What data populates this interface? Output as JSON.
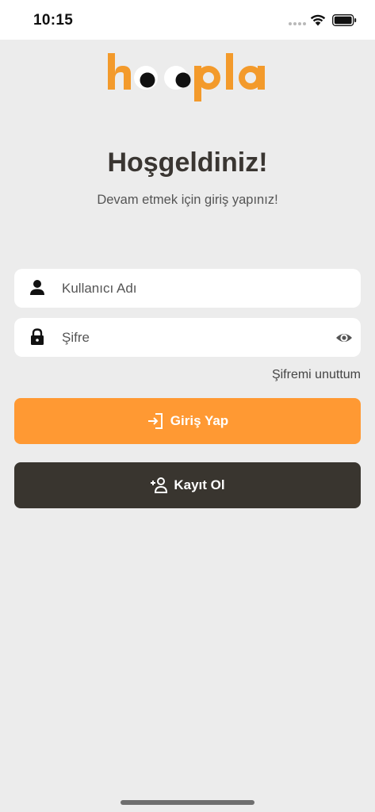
{
  "status_bar": {
    "time": "10:15"
  },
  "logo": {
    "text": "hoopla",
    "color": "#f39a2b"
  },
  "welcome": {
    "title": "Hoşgeldiniz!",
    "subtitle": "Devam etmek için giriş yapınız!"
  },
  "form": {
    "username_placeholder": "Kullanıcı Adı",
    "username_value": "",
    "password_placeholder": "Şifre",
    "password_value": "",
    "forgot_label": "Şifremi unuttum"
  },
  "buttons": {
    "login_label": "Giriş Yap",
    "register_label": "Kayıt Ol"
  },
  "colors": {
    "accent": "#ff9933",
    "dark": "#39352f",
    "background": "#ececec"
  }
}
